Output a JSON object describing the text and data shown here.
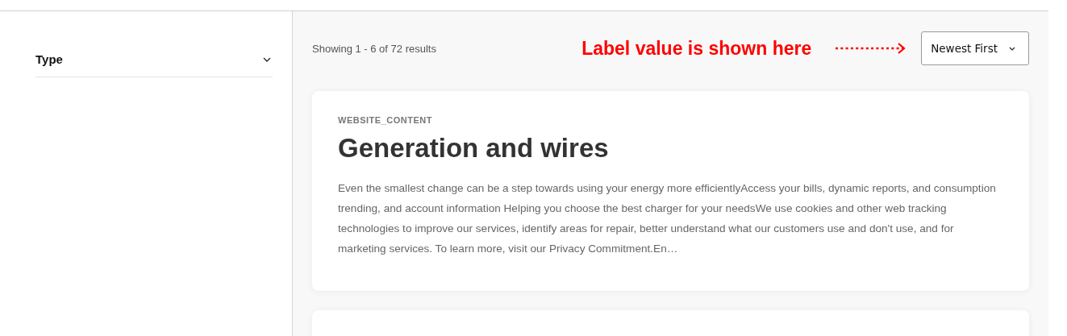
{
  "sidebar": {
    "filters": [
      {
        "label": "Type",
        "expanded": false
      }
    ]
  },
  "results": {
    "summary": "Showing 1 - 6 of 72 results",
    "annotation": "Label value is shown here",
    "sort": {
      "value": "Newest First"
    },
    "cards": [
      {
        "tag": "WEBSITE_CONTENT",
        "title": "Generation and wires",
        "description": "Even the smallest change can be a step towards using your energy more efficientlyAccess your bills, dynamic reports, and consumption trending, and account information Helping you choose the best charger for your needsWe use cookies and other web tracking technologies to improve our services, identify areas for repair, better understand what our customers use and don't use, and for marketing services. To learn more, visit our Privacy Commitment.En…"
      }
    ],
    "more_cards_below": true
  }
}
